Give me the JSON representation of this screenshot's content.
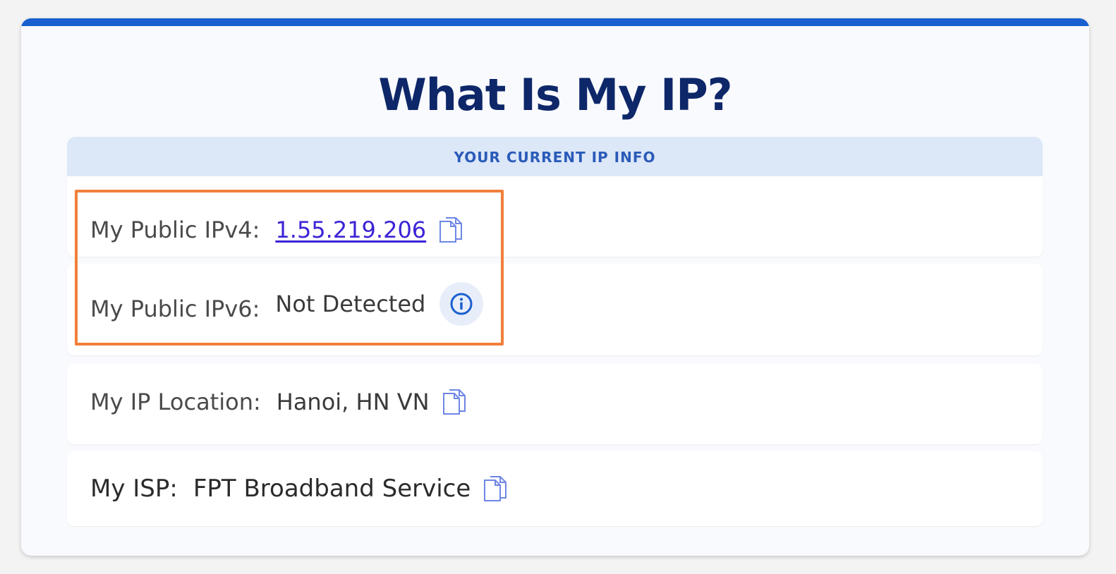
{
  "page": {
    "title": "What Is My IP?"
  },
  "section": {
    "header": "YOUR CURRENT IP INFO"
  },
  "rows": {
    "ipv4": {
      "label": "My Public IPv4:",
      "value": "1.55.219.206"
    },
    "ipv6": {
      "label": "My Public IPv6:",
      "value": "Not Detected"
    },
    "location": {
      "label": "My IP Location:",
      "value": "Hanoi, HN VN"
    },
    "isp": {
      "label": "My ISP:",
      "value": "FPT Broadband Service"
    }
  },
  "icons": {
    "copy": "copy-icon",
    "info": "info-icon"
  },
  "colors": {
    "accent": "#1a5fd0",
    "title": "#0d2769",
    "header_bg": "#dce7f8",
    "header_text": "#2a5bb8",
    "link": "#3b24d6",
    "highlight": "#f27f3a"
  }
}
